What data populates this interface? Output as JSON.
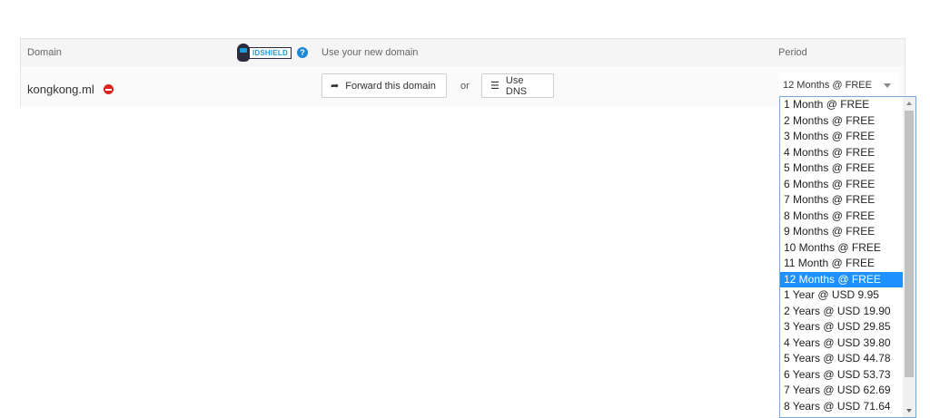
{
  "header": {
    "domain_label": "Domain",
    "idshield_label": "IDSHIELD",
    "help_symbol": "?",
    "use_domain_label": "Use your new domain",
    "period_label": "Period"
  },
  "row": {
    "domain": "kongkong.ml",
    "forward_button": "Forward this domain",
    "or_text": "or",
    "dns_button": "Use DNS",
    "selected_period": "12 Months @ FREE"
  },
  "period_options": [
    "1 Month @ FREE",
    "2 Months @ FREE",
    "3 Months @ FREE",
    "4 Months @ FREE",
    "5 Months @ FREE",
    "6 Months @ FREE",
    "7 Months @ FREE",
    "8 Months @ FREE",
    "9 Months @ FREE",
    "10 Months @ FREE",
    "11 Month @ FREE",
    "12 Months @ FREE",
    "1 Year @ USD 9.95",
    "2 Years @ USD 19.90",
    "3 Years @ USD 29.85",
    "4 Years @ USD 39.80",
    "5 Years @ USD 44.78",
    "6 Years @ USD 53.73",
    "7 Years @ USD 62.69",
    "8 Years @ USD 71.64"
  ],
  "selected_index": 11,
  "colors": {
    "remove_icon": "#d9231f",
    "help_icon": "#1d88d6",
    "selection": "#1e90ff"
  },
  "icons": {
    "remove": "minus-circle-icon",
    "forward": "share-arrow-icon",
    "dns": "list-icon",
    "help": "question-circle-icon"
  }
}
